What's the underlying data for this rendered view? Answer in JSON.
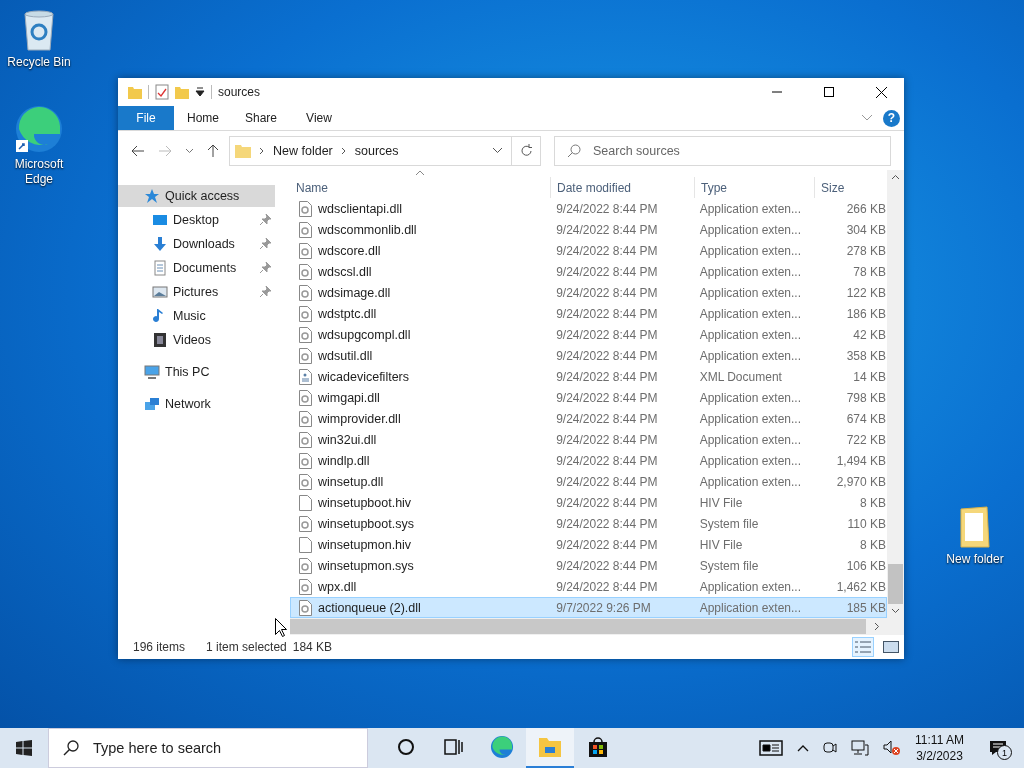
{
  "desktop_icons": [
    {
      "label": "Recycle Bin",
      "kind": "recycle"
    },
    {
      "label": "Microsoft Edge",
      "kind": "edge"
    },
    {
      "label": "New folder",
      "kind": "folder"
    }
  ],
  "window": {
    "title": "sources",
    "help_label": "?",
    "ribbon_tabs": [
      {
        "label": "File",
        "kind": "file",
        "selected": false
      },
      {
        "label": "Home",
        "kind": "tab",
        "selected": false
      },
      {
        "label": "Share",
        "kind": "tab",
        "selected": false
      },
      {
        "label": "View",
        "kind": "tab",
        "selected": false
      }
    ],
    "breadcrumb": [
      "New folder",
      "sources"
    ],
    "search_placeholder": "Search sources",
    "nav": [
      {
        "label": "Quick access",
        "kind": "star",
        "selected": true,
        "children": [
          {
            "label": "Desktop",
            "kind": "desktop",
            "pinned": true,
            "selected": false
          },
          {
            "label": "Downloads",
            "kind": "downloads",
            "pinned": true,
            "selected": false
          },
          {
            "label": "Documents",
            "kind": "documents",
            "pinned": true,
            "selected": false
          },
          {
            "label": "Pictures",
            "kind": "pictures",
            "pinned": true,
            "selected": false
          },
          {
            "label": "Music",
            "kind": "music",
            "pinned": false,
            "selected": false
          },
          {
            "label": "Videos",
            "kind": "videos",
            "pinned": false,
            "selected": false
          }
        ]
      },
      {
        "label": "This PC",
        "kind": "pc",
        "selected": false
      },
      {
        "label": "Network",
        "kind": "network",
        "selected": false
      }
    ],
    "columns": [
      "Name",
      "Date modified",
      "Type",
      "Size"
    ],
    "rows": [
      {
        "name": "wdsclientapi.dll",
        "date": "9/24/2022 8:44 PM",
        "type": "Application exten...",
        "size": "266 KB",
        "kind": "dll",
        "selected": false
      },
      {
        "name": "wdscommonlib.dll",
        "date": "9/24/2022 8:44 PM",
        "type": "Application exten...",
        "size": "304 KB",
        "kind": "dll",
        "selected": false
      },
      {
        "name": "wdscore.dll",
        "date": "9/24/2022 8:44 PM",
        "type": "Application exten...",
        "size": "278 KB",
        "kind": "dll",
        "selected": false
      },
      {
        "name": "wdscsl.dll",
        "date": "9/24/2022 8:44 PM",
        "type": "Application exten...",
        "size": "78 KB",
        "kind": "dll",
        "selected": false
      },
      {
        "name": "wdsimage.dll",
        "date": "9/24/2022 8:44 PM",
        "type": "Application exten...",
        "size": "122 KB",
        "kind": "dll",
        "selected": false
      },
      {
        "name": "wdstptc.dll",
        "date": "9/24/2022 8:44 PM",
        "type": "Application exten...",
        "size": "186 KB",
        "kind": "dll",
        "selected": false
      },
      {
        "name": "wdsupgcompl.dll",
        "date": "9/24/2022 8:44 PM",
        "type": "Application exten...",
        "size": "42 KB",
        "kind": "dll",
        "selected": false
      },
      {
        "name": "wdsutil.dll",
        "date": "9/24/2022 8:44 PM",
        "type": "Application exten...",
        "size": "358 KB",
        "kind": "dll",
        "selected": false
      },
      {
        "name": "wicadevicefilters",
        "date": "9/24/2022 8:44 PM",
        "type": "XML Document",
        "size": "14 KB",
        "kind": "xml",
        "selected": false
      },
      {
        "name": "wimgapi.dll",
        "date": "9/24/2022 8:44 PM",
        "type": "Application exten...",
        "size": "798 KB",
        "kind": "dll",
        "selected": false
      },
      {
        "name": "wimprovider.dll",
        "date": "9/24/2022 8:44 PM",
        "type": "Application exten...",
        "size": "674 KB",
        "kind": "dll",
        "selected": false
      },
      {
        "name": "win32ui.dll",
        "date": "9/24/2022 8:44 PM",
        "type": "Application exten...",
        "size": "722 KB",
        "kind": "dll",
        "selected": false
      },
      {
        "name": "windlp.dll",
        "date": "9/24/2022 8:44 PM",
        "type": "Application exten...",
        "size": "1,494 KB",
        "kind": "dll",
        "selected": false
      },
      {
        "name": "winsetup.dll",
        "date": "9/24/2022 8:44 PM",
        "type": "Application exten...",
        "size": "2,970 KB",
        "kind": "dll",
        "selected": false
      },
      {
        "name": "winsetupboot.hiv",
        "date": "9/24/2022 8:44 PM",
        "type": "HIV File",
        "size": "8 KB",
        "kind": "blank",
        "selected": false
      },
      {
        "name": "winsetupboot.sys",
        "date": "9/24/2022 8:44 PM",
        "type": "System file",
        "size": "110 KB",
        "kind": "dll",
        "selected": false
      },
      {
        "name": "winsetupmon.hiv",
        "date": "9/24/2022 8:44 PM",
        "type": "HIV File",
        "size": "8 KB",
        "kind": "blank",
        "selected": false
      },
      {
        "name": "winsetupmon.sys",
        "date": "9/24/2022 8:44 PM",
        "type": "System file",
        "size": "106 KB",
        "kind": "dll",
        "selected": false
      },
      {
        "name": "wpx.dll",
        "date": "9/24/2022 8:44 PM",
        "type": "Application exten...",
        "size": "1,462 KB",
        "kind": "dll",
        "selected": false
      },
      {
        "name": "actionqueue (2).dll",
        "date": "9/7/2022 9:26 PM",
        "type": "Application exten...",
        "size": "185 KB",
        "kind": "dll",
        "selected": true
      }
    ],
    "status": {
      "count": "196 items",
      "selection": "1 item selected",
      "size": "184 KB"
    }
  },
  "taskbar": {
    "search_placeholder": "Type here to search",
    "apps": [
      {
        "kind": "cortana",
        "active": false
      },
      {
        "kind": "taskview",
        "active": false
      },
      {
        "kind": "edge",
        "active": false
      },
      {
        "kind": "explorer",
        "active": true
      },
      {
        "kind": "store",
        "active": false
      }
    ],
    "time": "11:11 AM",
    "date": "3/2/2023",
    "notification_count": "1"
  }
}
